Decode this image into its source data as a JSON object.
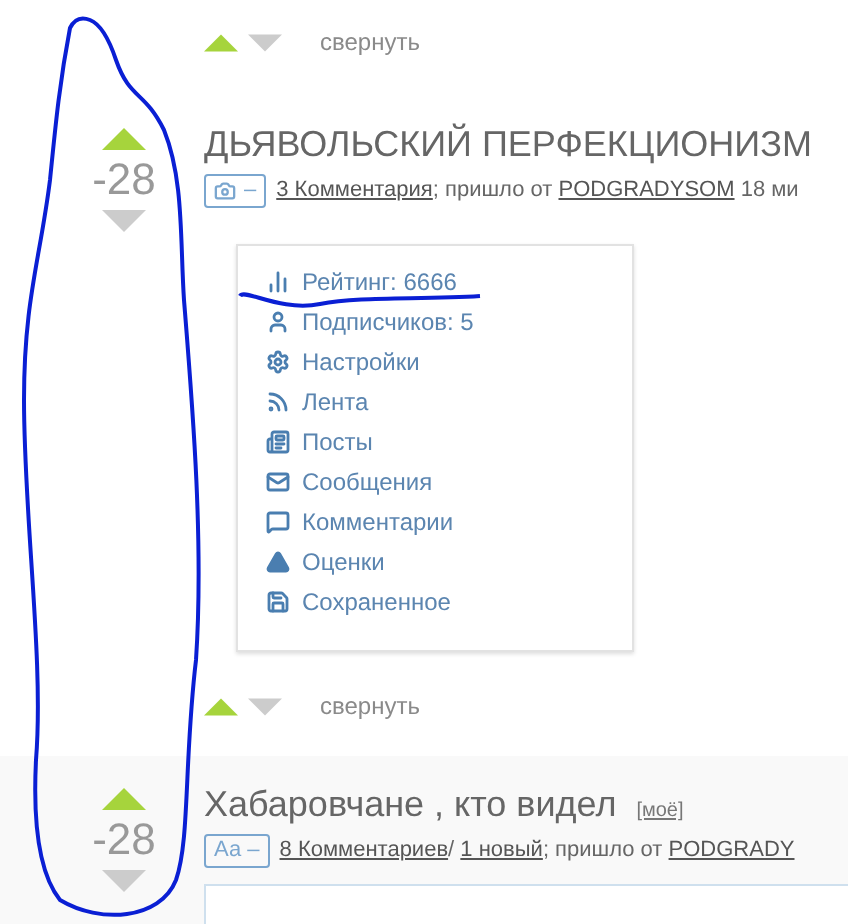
{
  "top_collapse": {
    "label": "свернуть"
  },
  "posts": [
    {
      "score": "-28",
      "title": "ДЬЯВОЛЬСКИЙ ПЕРФЕКЦИОНИЗМ",
      "badge": {
        "kind": "photo",
        "text": "–"
      },
      "meta": [
        {
          "kind": "link",
          "text": "3 Комментария"
        },
        {
          "kind": "text",
          "text": "; пришло от "
        },
        {
          "kind": "link",
          "text": "PODGRADYSOM"
        },
        {
          "kind": "text",
          "text": " 18 ми"
        }
      ],
      "menu": [
        {
          "label": "Рейтинг: 6666"
        },
        {
          "label": "Подписчиков: 5"
        },
        {
          "label": "Настройки"
        },
        {
          "label": "Лента"
        },
        {
          "label": "Посты"
        },
        {
          "label": "Сообщения"
        },
        {
          "label": "Комментарии"
        },
        {
          "label": "Оценки"
        },
        {
          "label": "Сохраненное"
        }
      ],
      "collapse": "свернуть"
    },
    {
      "score": "-28",
      "title": "Хабаровчане , кто видел",
      "tag": "[моё]",
      "badge": {
        "kind": "text",
        "text": "Аа –"
      },
      "meta": [
        {
          "kind": "link",
          "text": "8 Комментариев"
        },
        {
          "kind": "text",
          "text": "/ "
        },
        {
          "kind": "link",
          "text": "1 новый"
        },
        {
          "kind": "text",
          "text": "; пришло от "
        },
        {
          "kind": "link",
          "text": "PODGRADY"
        }
      ]
    }
  ]
}
